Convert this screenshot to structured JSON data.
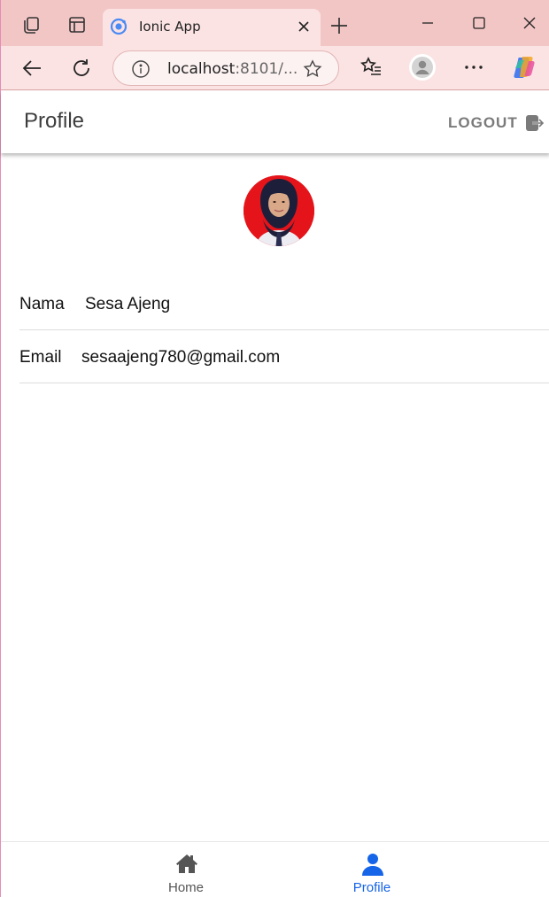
{
  "browser": {
    "tab_title": "Ionic App",
    "url_host": "localhost",
    "url_rest": ":8101/..."
  },
  "header": {
    "title": "Profile",
    "logout_label": "LOGOUT"
  },
  "profile": {
    "fields": [
      {
        "label": "Nama",
        "value": "Sesa Ajeng"
      },
      {
        "label": "Email",
        "value": "sesaajeng780@gmail.com"
      }
    ]
  },
  "tabbar": {
    "tabs": [
      {
        "label": "Home",
        "icon": "home-icon",
        "selected": false
      },
      {
        "label": "Profile",
        "icon": "person-icon",
        "selected": true
      }
    ]
  },
  "colors": {
    "chrome_tab_bg": "#f3c6c6",
    "chrome_active_bg": "#fbe3e3",
    "tab_selected": "#1664e8",
    "tab_unselected": "#555555",
    "photo_bg": "#e4141a"
  }
}
